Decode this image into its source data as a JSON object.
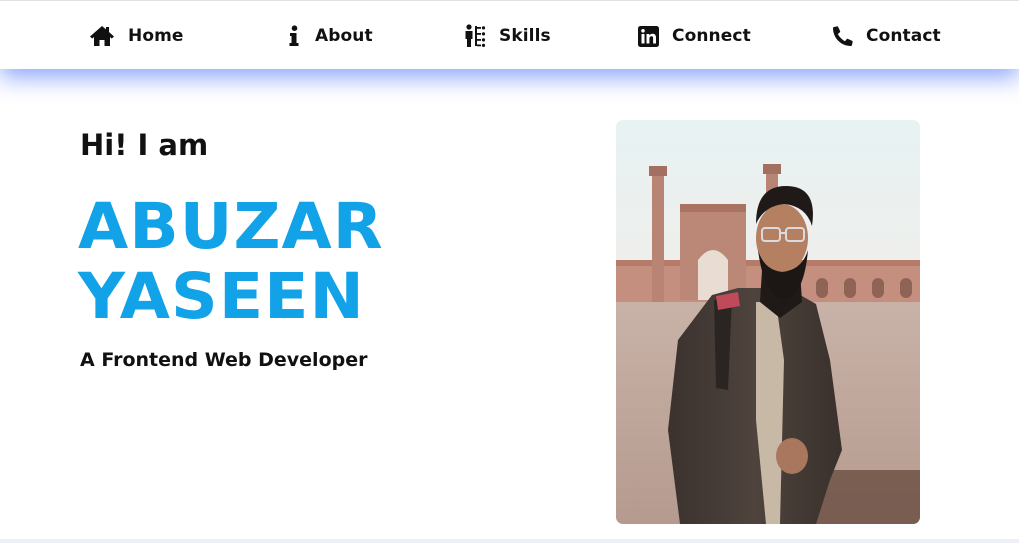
{
  "nav": {
    "items": [
      {
        "label": "Home",
        "icon": "home-icon"
      },
      {
        "label": "About",
        "icon": "info-icon"
      },
      {
        "label": "Skills",
        "icon": "skills-icon"
      },
      {
        "label": "Connect",
        "icon": "linkedin-icon"
      },
      {
        "label": "Contact",
        "icon": "phone-icon"
      }
    ]
  },
  "hero": {
    "greeting": "Hi! I am",
    "first_name": "ABUZAR",
    "last_name": "YASEEN",
    "role": "A Frontend Web Developer"
  },
  "colors": {
    "accent": "#12a2e8",
    "text": "#111111",
    "nav_shadow": "#2a5cff"
  }
}
